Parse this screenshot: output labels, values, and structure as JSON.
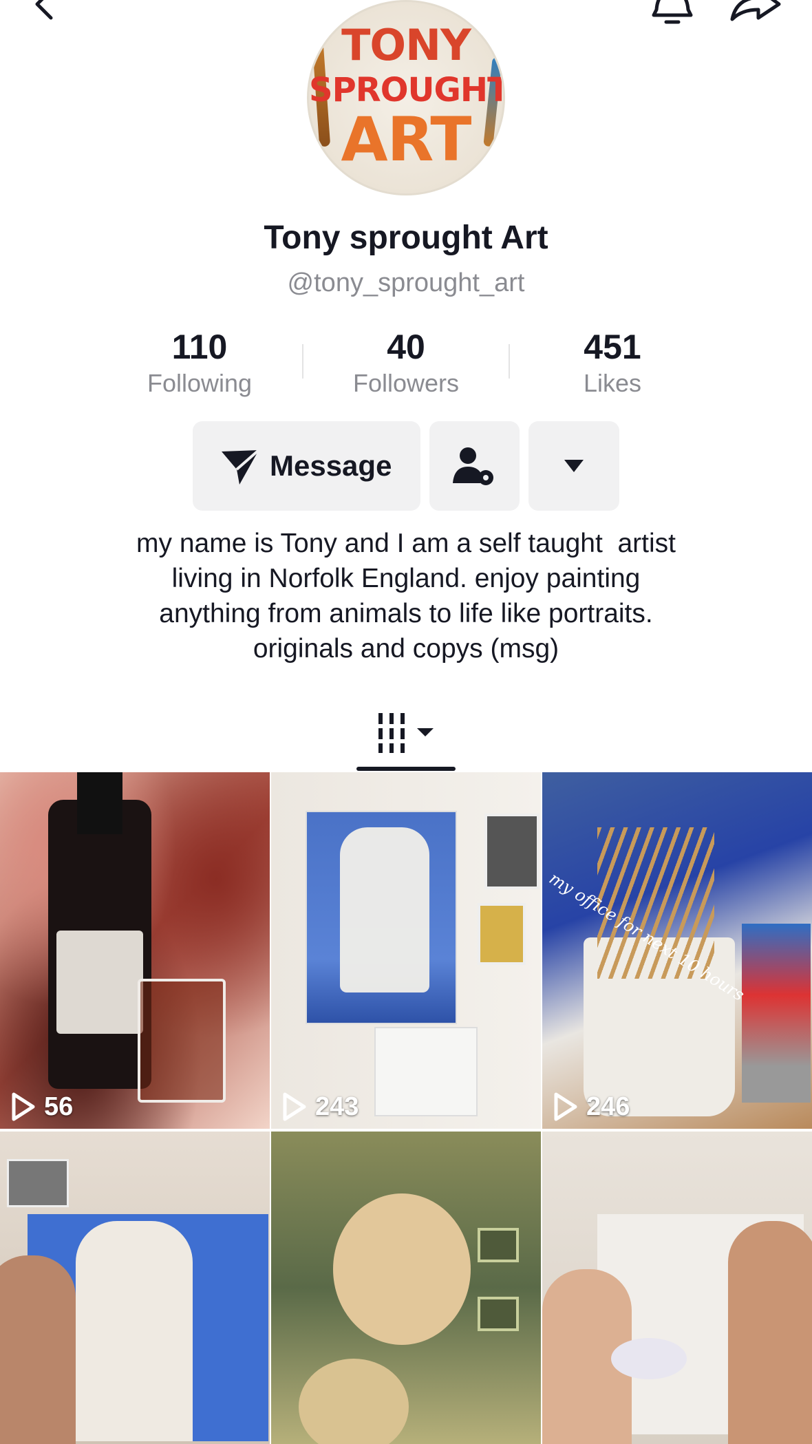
{
  "topbar": {
    "back_icon": "chevron-left-icon",
    "bell_icon": "bell-icon",
    "share_icon": "share-arrow-icon"
  },
  "profile": {
    "logo_lines": [
      "TONY",
      "SPROUGHT",
      "ART"
    ],
    "display_name": "Tony sprought Art",
    "handle": "@tony_sprought_art"
  },
  "stats": [
    {
      "value": "110",
      "label": "Following"
    },
    {
      "value": "40",
      "label": "Followers"
    },
    {
      "value": "451",
      "label": "Likes"
    }
  ],
  "actions": {
    "message_label": "Message",
    "message_icon": "send-icon",
    "friend_icon": "user-settings-icon",
    "more_icon": "caret-down-icon"
  },
  "bio": [
    "my name is Tony and I am a self taught  artist",
    "living in Norfolk England. enjoy painting",
    "anything from animals to life like portraits.",
    "originals and copys (msg)"
  ],
  "tabs": {
    "videos_icon": "grid-icon"
  },
  "videos": [
    {
      "views": "56"
    },
    {
      "views": "243"
    },
    {
      "views": "246",
      "overlay_text": "my office for next 10 hours"
    },
    {
      "views": ""
    },
    {
      "views": ""
    },
    {
      "views": ""
    }
  ],
  "colors": {
    "text": "#161823",
    "secondary": "#8a8b91",
    "button_bg": "#f1f1f2"
  }
}
